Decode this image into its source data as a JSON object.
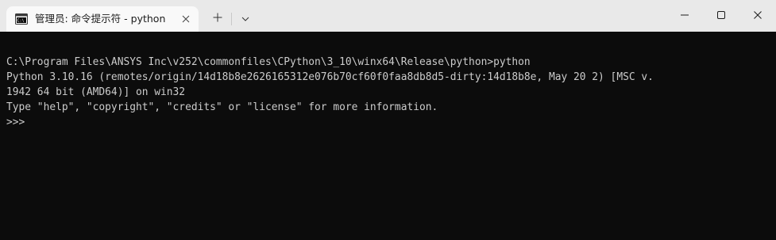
{
  "tab": {
    "title": "管理员: 命令提示符 - python",
    "icon": "cmd-icon"
  },
  "titlebar": {
    "new_tab_icon": "plus-icon",
    "dropdown_icon": "chevron-down-icon",
    "minimize_icon": "minimize-icon",
    "maximize_icon": "maximize-icon",
    "close_icon": "close-icon"
  },
  "terminal": {
    "lines": [
      "C:\\Program Files\\ANSYS Inc\\v252\\commonfiles\\CPython\\3_10\\winx64\\Release\\python>python",
      "Python 3.10.16 (remotes/origin/14d18b8e2626165312e076b70cf60f0faa8db8d5-dirty:14d18b8e, May 20 2) [MSC v.",
      "1942 64 bit (AMD64)] on win32",
      "Type \"help\", \"copyright\", \"credits\" or \"license\" for more information.",
      ">>> "
    ]
  },
  "colors": {
    "terminal_bg": "#0c0c0c",
    "terminal_fg": "#cccccc",
    "titlebar_bg": "#e9e9e9",
    "active_tab_bg": "#f9f9f9"
  }
}
